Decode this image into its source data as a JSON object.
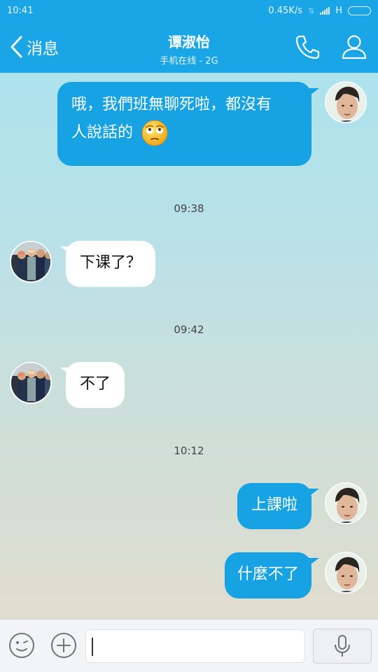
{
  "status_bar": {
    "time": "10:41",
    "speed": "0.45K/s",
    "network": "H"
  },
  "header": {
    "back_label": "消息",
    "contact_name": "谭淑怡",
    "contact_status": "手机在线 - 2G",
    "icons": [
      "phone-icon",
      "profile-icon",
      "back-chevron-icon"
    ]
  },
  "messages": [
    {
      "side": "out",
      "text_line1": "哦，我們班無聊死啦，都沒有",
      "text_line2": "人說話的",
      "emoji": "rolling-eyes-emoji"
    },
    {
      "type": "time",
      "text": "09:38"
    },
    {
      "side": "in",
      "text": "下课了？"
    },
    {
      "type": "time",
      "text": "09:42"
    },
    {
      "side": "in",
      "text": "不了"
    },
    {
      "type": "time",
      "text": "10:12"
    },
    {
      "side": "out",
      "text": "上課啦"
    },
    {
      "side": "out",
      "text": "什麼不了"
    }
  ],
  "input_bar": {
    "icons": [
      "emoji-face-icon",
      "plus-icon",
      "microphone-icon"
    ],
    "input_value": ""
  },
  "colors": {
    "accent": "#1aa5e6",
    "outgoing_bubble": "#17a3e3",
    "incoming_bubble": "#ffffff"
  }
}
